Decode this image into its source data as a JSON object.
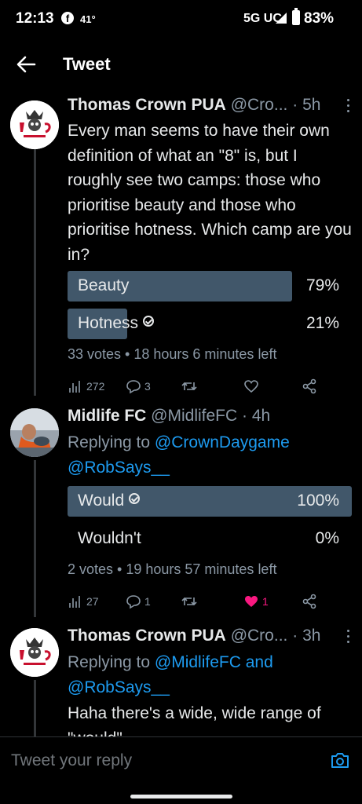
{
  "status_bar": {
    "time": "12:13",
    "temperature": "41°",
    "network": "5G UC",
    "battery": "83%"
  },
  "header": {
    "title": "Tweet",
    "back_icon": "arrow-left-icon"
  },
  "tweets": [
    {
      "name": "Thomas Crown PUA",
      "handle": "@Cro...",
      "time": "5h",
      "text": "Every man seems to have their own definition of what an \"8\" is, but I roughly see two camps: those who prioritise beauty and those who prioritise hotness. Which camp are you in?",
      "poll": {
        "options": [
          {
            "label": "Beauty",
            "percent": "79%",
            "fill": 0.79,
            "selected": false
          },
          {
            "label": "Hotness",
            "percent": "21%",
            "fill": 0.21,
            "selected": true
          }
        ],
        "meta": "33 votes • 18 hours 6 minutes left"
      },
      "actions": {
        "views": "272",
        "replies": "3",
        "retweets": "",
        "likes": ""
      }
    },
    {
      "name": "Midlife FC",
      "handle": "@MidlifeFC",
      "time": "4h",
      "reply_prefix": "Replying to",
      "reply_mentions": "@CrownDaygame @RobSays__",
      "poll": {
        "options": [
          {
            "label": "Would",
            "percent": "100%",
            "fill": 1.0,
            "selected": true
          },
          {
            "label": "Wouldn't",
            "percent": "0%",
            "fill": 0.0,
            "selected": false
          }
        ],
        "meta": "2 votes • 19 hours 57 minutes left"
      },
      "actions": {
        "views": "27",
        "replies": "1",
        "retweets": "",
        "likes": "1"
      }
    },
    {
      "name": "Thomas Crown PUA",
      "handle": "@Cro...",
      "time": "3h",
      "reply_prefix": "Replying to",
      "reply_mentions": "@MidlifeFC and @RobSays__",
      "text": "Haha there's a wide, wide range of \"would\""
    }
  ],
  "reply_bar": {
    "placeholder": "Tweet your reply"
  },
  "colors": {
    "accent": "#1d9bf0",
    "poll_bar": "#41576a",
    "like": "#f91880"
  }
}
